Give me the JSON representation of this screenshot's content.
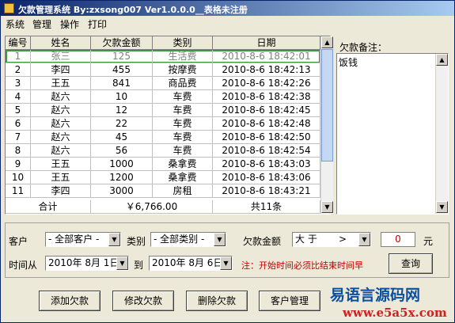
{
  "window": {
    "title": "欠款管理系统 By:zxsong007 Ver1.0.0.0__表格未注册"
  },
  "menu": [
    "系统",
    "管理",
    "操作",
    "打印"
  ],
  "table": {
    "headers": [
      "编号",
      "姓名",
      "欠款金额",
      "类别",
      "日期"
    ],
    "rows": [
      [
        "1",
        "张三",
        "125",
        "生活费",
        "2010-8-6 18:42:01"
      ],
      [
        "2",
        "李四",
        "455",
        "按摩费",
        "2010-8-6 18:42:13"
      ],
      [
        "3",
        "王五",
        "841",
        "商品费",
        "2010-8-6 18:42:26"
      ],
      [
        "4",
        "赵六",
        "10",
        "车费",
        "2010-8-6 18:42:38"
      ],
      [
        "5",
        "赵六",
        "12",
        "车费",
        "2010-8-6 18:42:45"
      ],
      [
        "6",
        "赵六",
        "22",
        "车费",
        "2010-8-6 18:42:48"
      ],
      [
        "7",
        "赵六",
        "45",
        "车费",
        "2010-8-6 18:42:50"
      ],
      [
        "8",
        "赵六",
        "56",
        "车费",
        "2010-8-6 18:42:54"
      ],
      [
        "9",
        "王五",
        "1000",
        "桑拿费",
        "2010-8-6 18:43:03"
      ],
      [
        "10",
        "王五",
        "1200",
        "桑拿费",
        "2010-8-6 18:43:06"
      ],
      [
        "11",
        "李四",
        "3000",
        "房租",
        "2010-8-6 18:43:21"
      ]
    ],
    "total": {
      "label": "合计",
      "amount": "￥6,766.00",
      "count": "共11条"
    }
  },
  "note": {
    "label": "欠款备注：",
    "text": "饭钱"
  },
  "filter": {
    "customer_label": "客户",
    "customer_value": "- 全部客户 -",
    "category_label": "类别",
    "category_value": "- 全部类别 -",
    "amount_label": "欠款金额",
    "amount_op": "大  于",
    "amount_op_symbol": ">",
    "amount_value": "0",
    "amount_unit": "元",
    "time_from_label": "时间从",
    "date_from": "2010年 8月 1日",
    "to_label": "到",
    "date_to": "2010年 8月 6日",
    "warning": "注：开始时间必须比结束时间早",
    "query_label": "查询"
  },
  "buttons": {
    "add": "添加欠款",
    "edit": "修改欠款",
    "delete": "删除欠款",
    "customers": "客户管理"
  },
  "watermark": {
    "main": "易语言源码网",
    "url": "www.e5a5x.com"
  }
}
